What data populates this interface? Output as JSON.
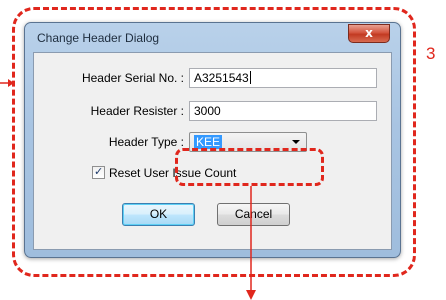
{
  "annotation": {
    "number": "3",
    "color": "#e0271d"
  },
  "dialog": {
    "title": "Change Header Dialog",
    "close_label": "x",
    "serial": {
      "label": "Header Serial No. :",
      "value": "A3251543"
    },
    "resister": {
      "label": "Header Resister :",
      "value": "3000"
    },
    "type": {
      "label": "Header Type :",
      "selected": "KEE"
    },
    "reset_checkbox": {
      "label": "Reset User Issue Count",
      "checked": true,
      "tick": "✓"
    },
    "ok_label": "OK",
    "cancel_label": "Cancel"
  }
}
